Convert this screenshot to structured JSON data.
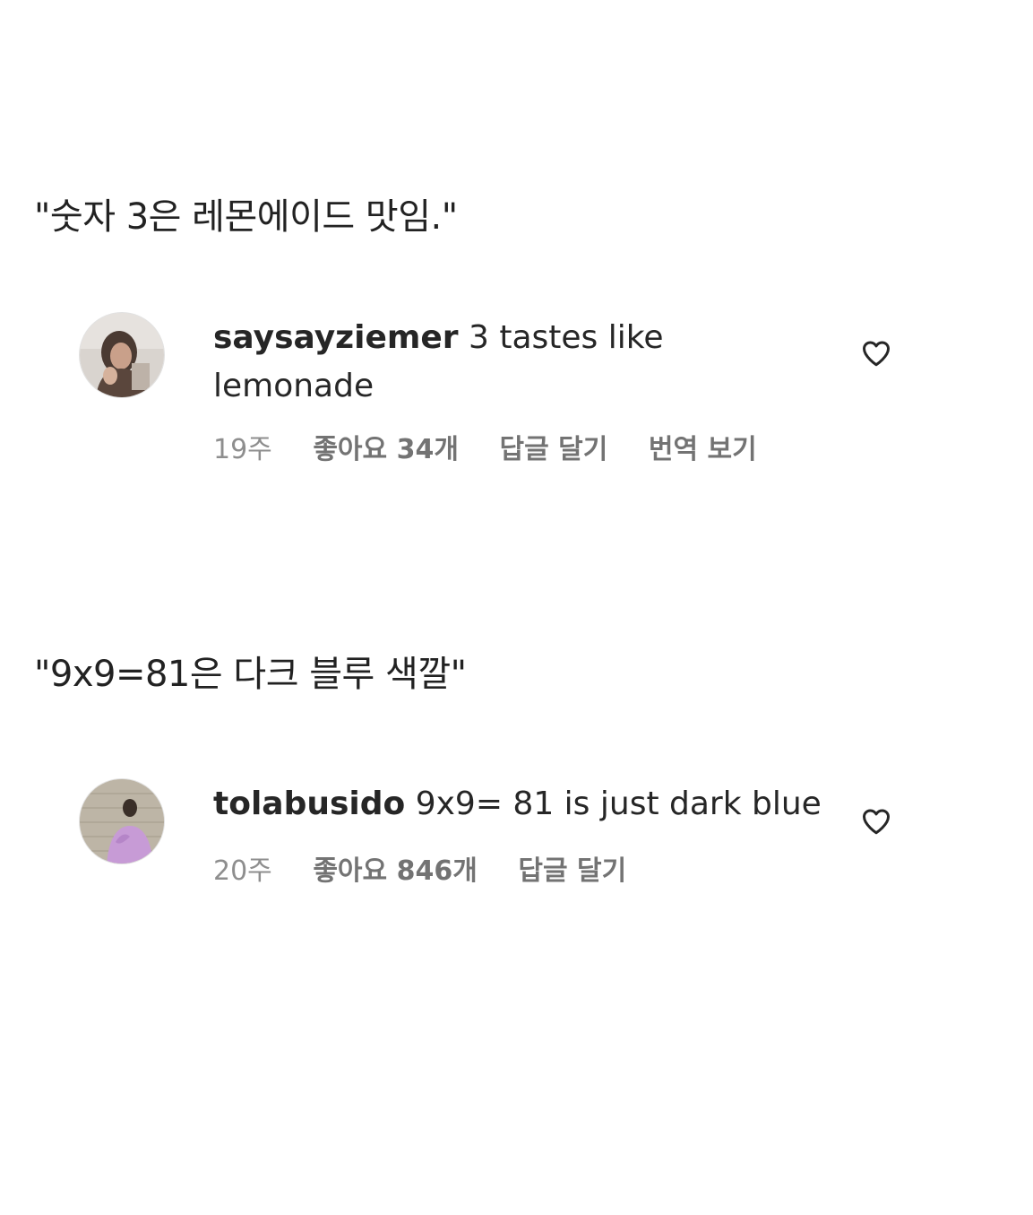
{
  "captions": [
    "\"숫자 3은 레몬에이드 맛임.\"",
    "\"9x9=81은 다크 블루 색깔\""
  ],
  "comments": [
    {
      "username": "saysayziemer",
      "text": "3 tastes like lemonade",
      "time": "19주",
      "likes": "좋아요 34개",
      "reply_label": "답글 달기",
      "translate_label": "번역 보기",
      "like_icon": "heart-outline-icon"
    },
    {
      "username": "tolabusido",
      "text": "9x9= 81 is just dark blue",
      "time": "20주",
      "likes": "좋아요 846개",
      "reply_label": "답글 달기",
      "like_icon": "heart-outline-icon"
    }
  ],
  "colors": {
    "text_primary": "#262626",
    "text_secondary": "#8e8e8e",
    "background": "#ffffff"
  }
}
